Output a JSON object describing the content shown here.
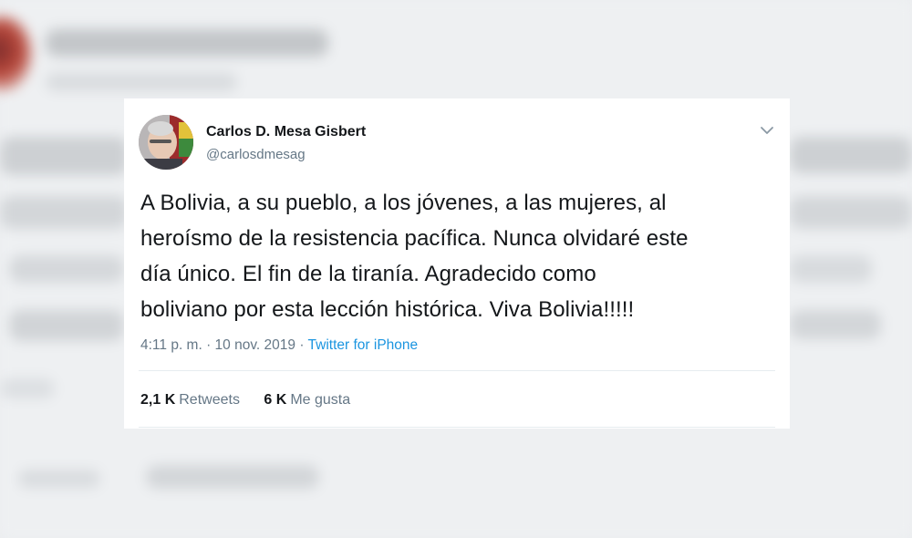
{
  "tweet": {
    "author_name": "Carlos D. Mesa Gisbert",
    "author_handle": "@carlosdmesag",
    "text_lines": [
      "A Bolivia, a su pueblo, a los jóvenes, a las mujeres, al",
      "heroísmo de la resistencia pacífica. Nunca olvidaré este",
      "día único. El fin de la tiranía. Agradecido como",
      "boliviano por esta lección histórica. Viva Bolivia!!!!!"
    ],
    "timestamp": "4:11 p. m. · 10 nov. 2019 · ",
    "source": "Twitter for iPhone",
    "retweets_count": "2,1 K",
    "retweets_label": "Retweets",
    "likes_count": "6 K",
    "likes_label": "Me gusta"
  },
  "icons": {
    "menu": "chevron-down-icon"
  },
  "colors": {
    "link": "#1b95e0",
    "secondary_text": "#657786",
    "primary_text": "#14171a"
  }
}
